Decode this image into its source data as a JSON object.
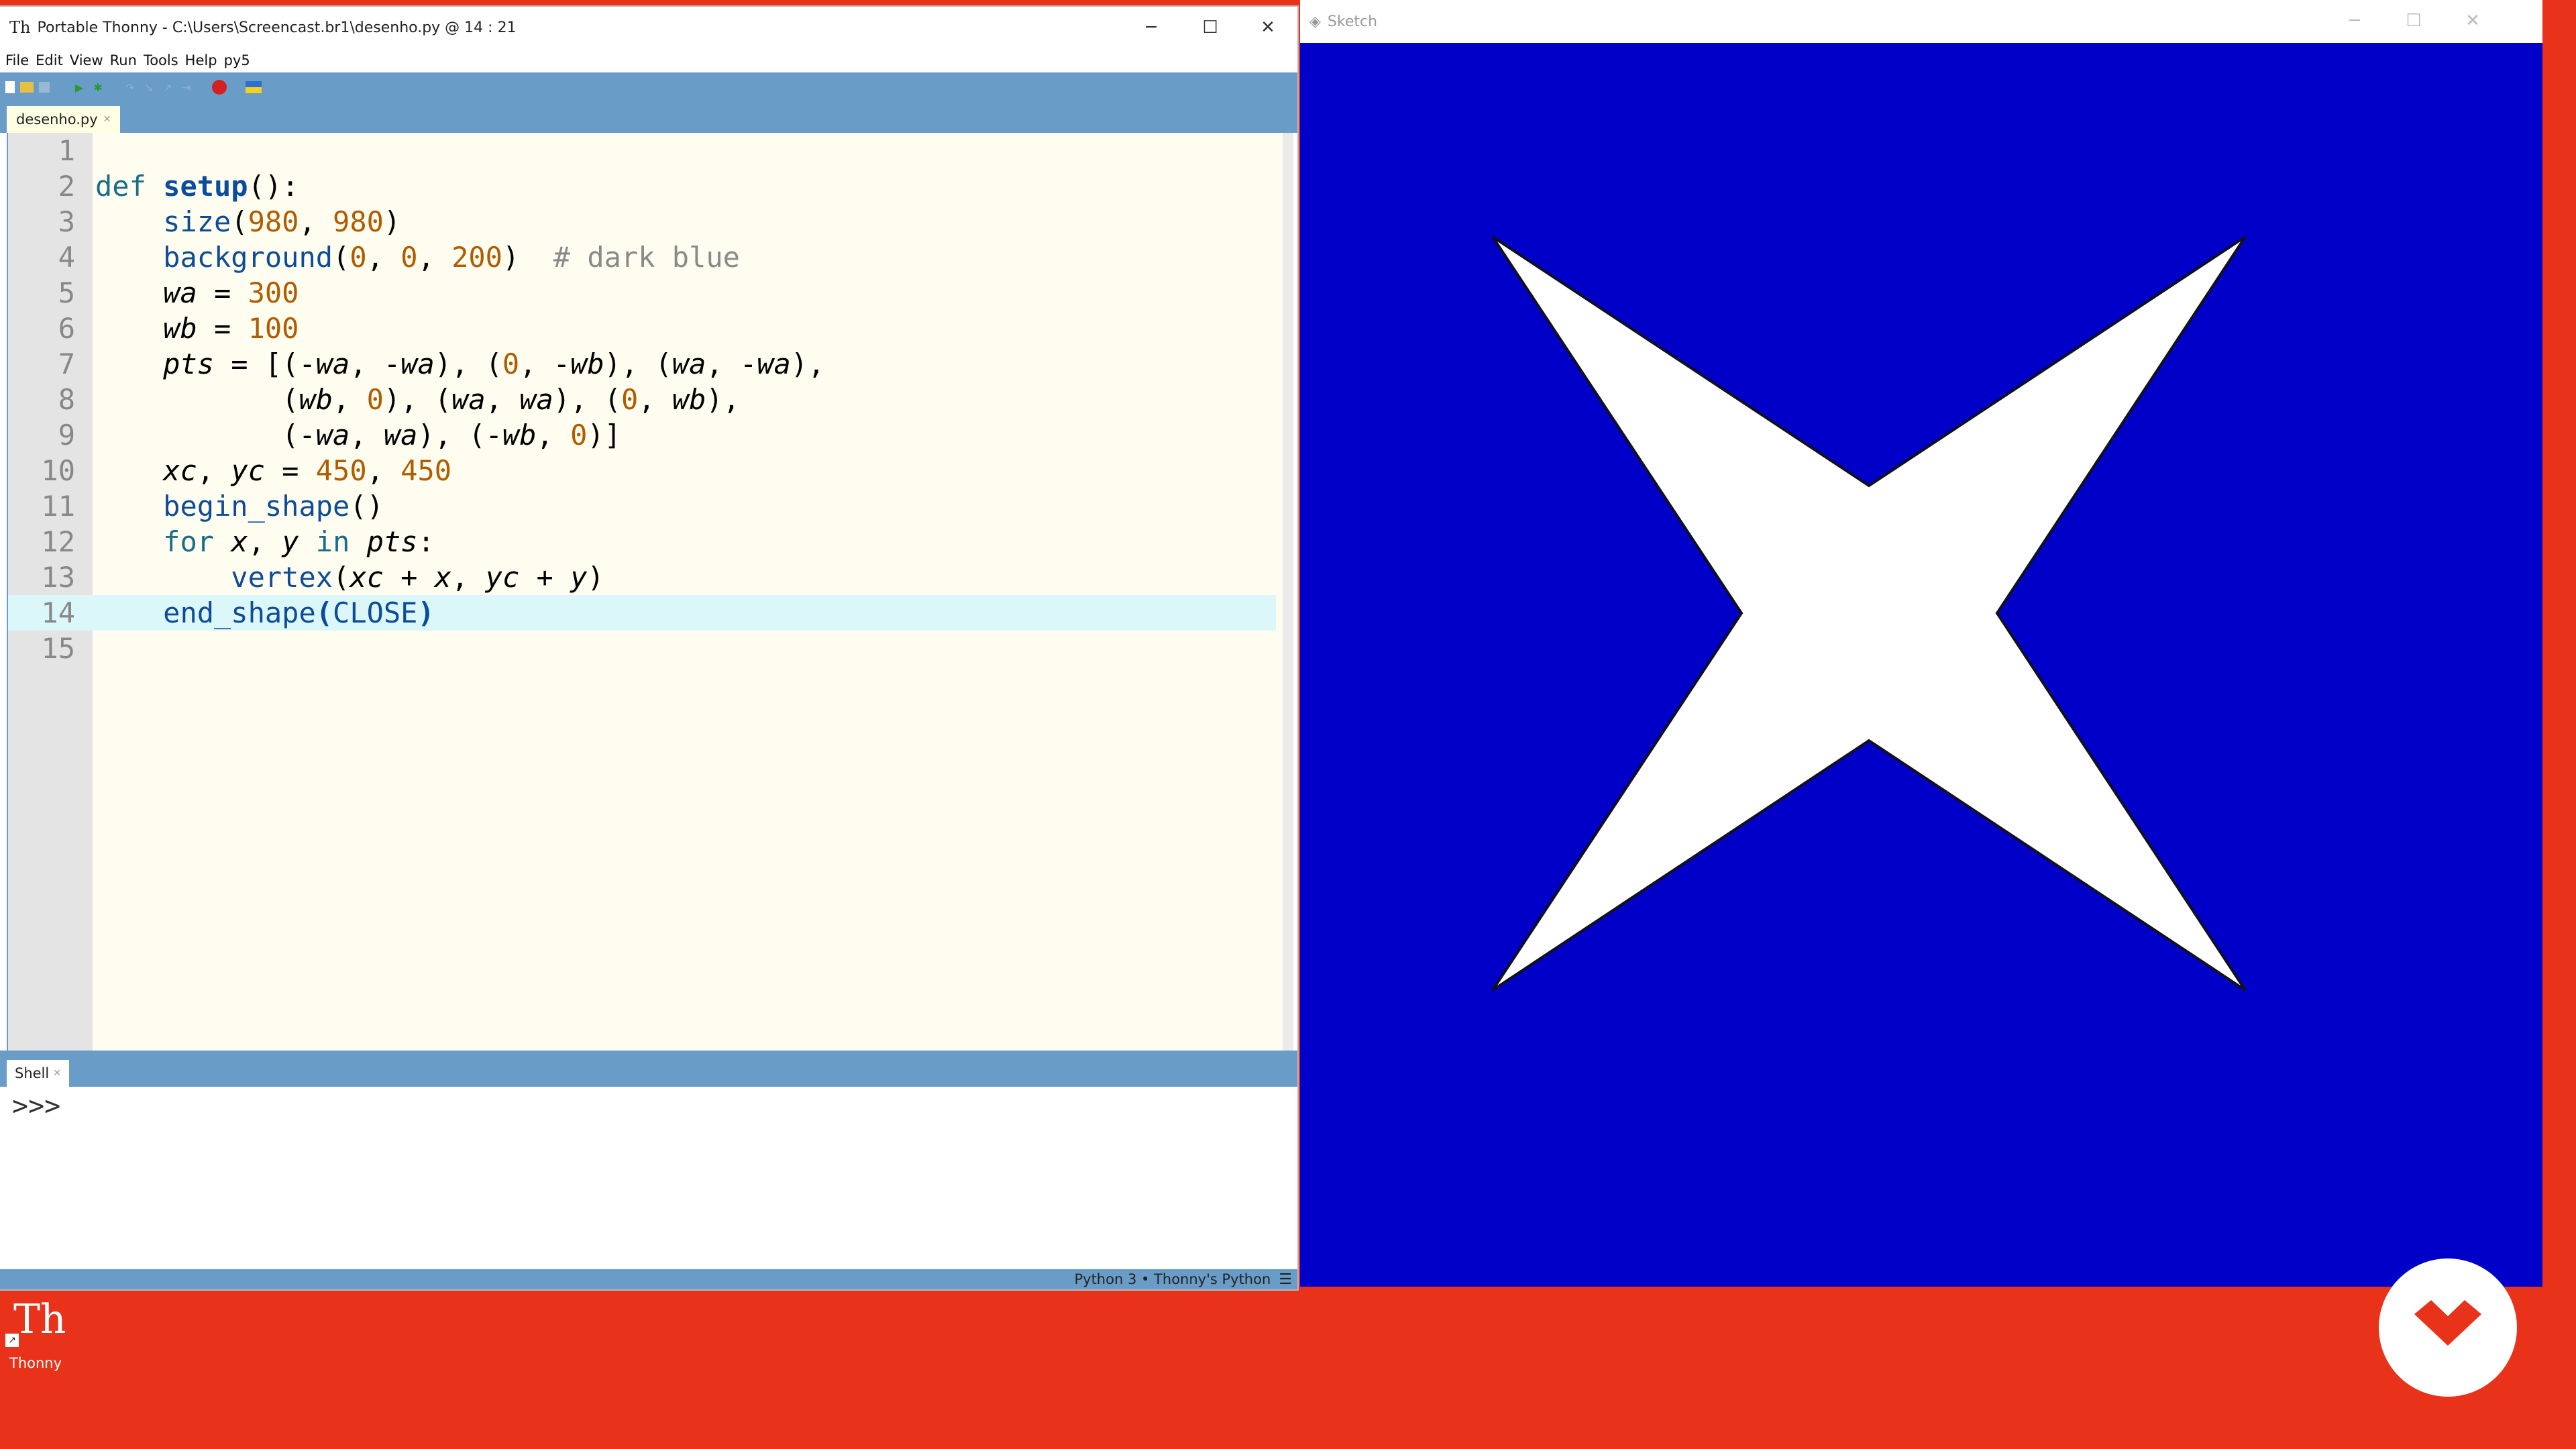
{
  "thonny": {
    "title": "Portable Thonny  -  C:\\Users\\Screencast.br1\\desenho.py  @  14 : 21",
    "menu": [
      "File",
      "Edit",
      "View",
      "Run",
      "Tools",
      "Help",
      "py5"
    ],
    "tab_label": "desenho.py",
    "code_lines": [
      "1",
      "2",
      "3",
      "4",
      "5",
      "6",
      "7",
      "8",
      "9",
      "10",
      "11",
      "12",
      "13",
      "14",
      "15"
    ],
    "shell_tab": "Shell",
    "shell_prompt": ">>>",
    "status": "Python 3  •  Thonny's Python"
  },
  "sketch": {
    "title": "Sketch",
    "background_color": "#0000c8",
    "shape_color": "#ffffff"
  },
  "desktop": {
    "icon_label": "Thonny"
  },
  "colors": {
    "desktop_bg": "#e8321a",
    "toolbar_blue": "#6a9cc8",
    "editor_bg": "#fffdf0"
  }
}
